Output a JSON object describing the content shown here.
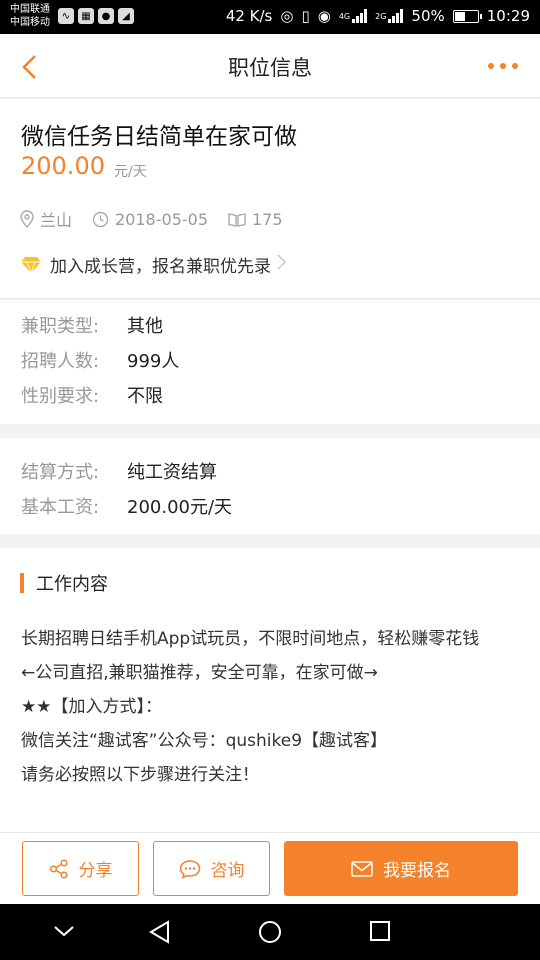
{
  "status_bar": {
    "carrier_1": "中国联通",
    "carrier_2": "中国移动",
    "net_speed": "42 K/s",
    "network_4g": "4G",
    "network_2g": "2G",
    "battery": "50%",
    "battery_level": 0.5,
    "time": "10:29"
  },
  "header": {
    "title": "职位信息"
  },
  "job": {
    "title": "微信任务日结简单在家可做",
    "salary": "200.00",
    "salary_unit": "元/天",
    "location": "兰山",
    "date": "2018-05-05",
    "views": "175",
    "promo": "加入成长营，报名兼职优先录"
  },
  "details": [
    {
      "label": "兼职类型:",
      "value": "其他"
    },
    {
      "label": "招聘人数:",
      "value": "999人"
    },
    {
      "label": "性别要求:",
      "value": "不限"
    }
  ],
  "payment": [
    {
      "label": "结算方式:",
      "value": "纯工资结算"
    },
    {
      "label": "基本工资:",
      "value": "200.00元/天"
    }
  ],
  "work": {
    "title": "工作内容",
    "lines": [
      "长期招聘日结手机App试玩员，不限时间地点，轻松赚零花钱",
      "←公司直招,兼职猫推荐，安全可靠，在家可做→",
      "★★【加入方式】：",
      "微信关注“趣试客”公众号：qushike9【趣试客】",
      "请务必按照以下步骤进行关注！"
    ]
  },
  "actions": {
    "share": "分享",
    "consult": "咨询",
    "apply": "我要报名"
  },
  "colors": {
    "accent": "#f5812a"
  }
}
